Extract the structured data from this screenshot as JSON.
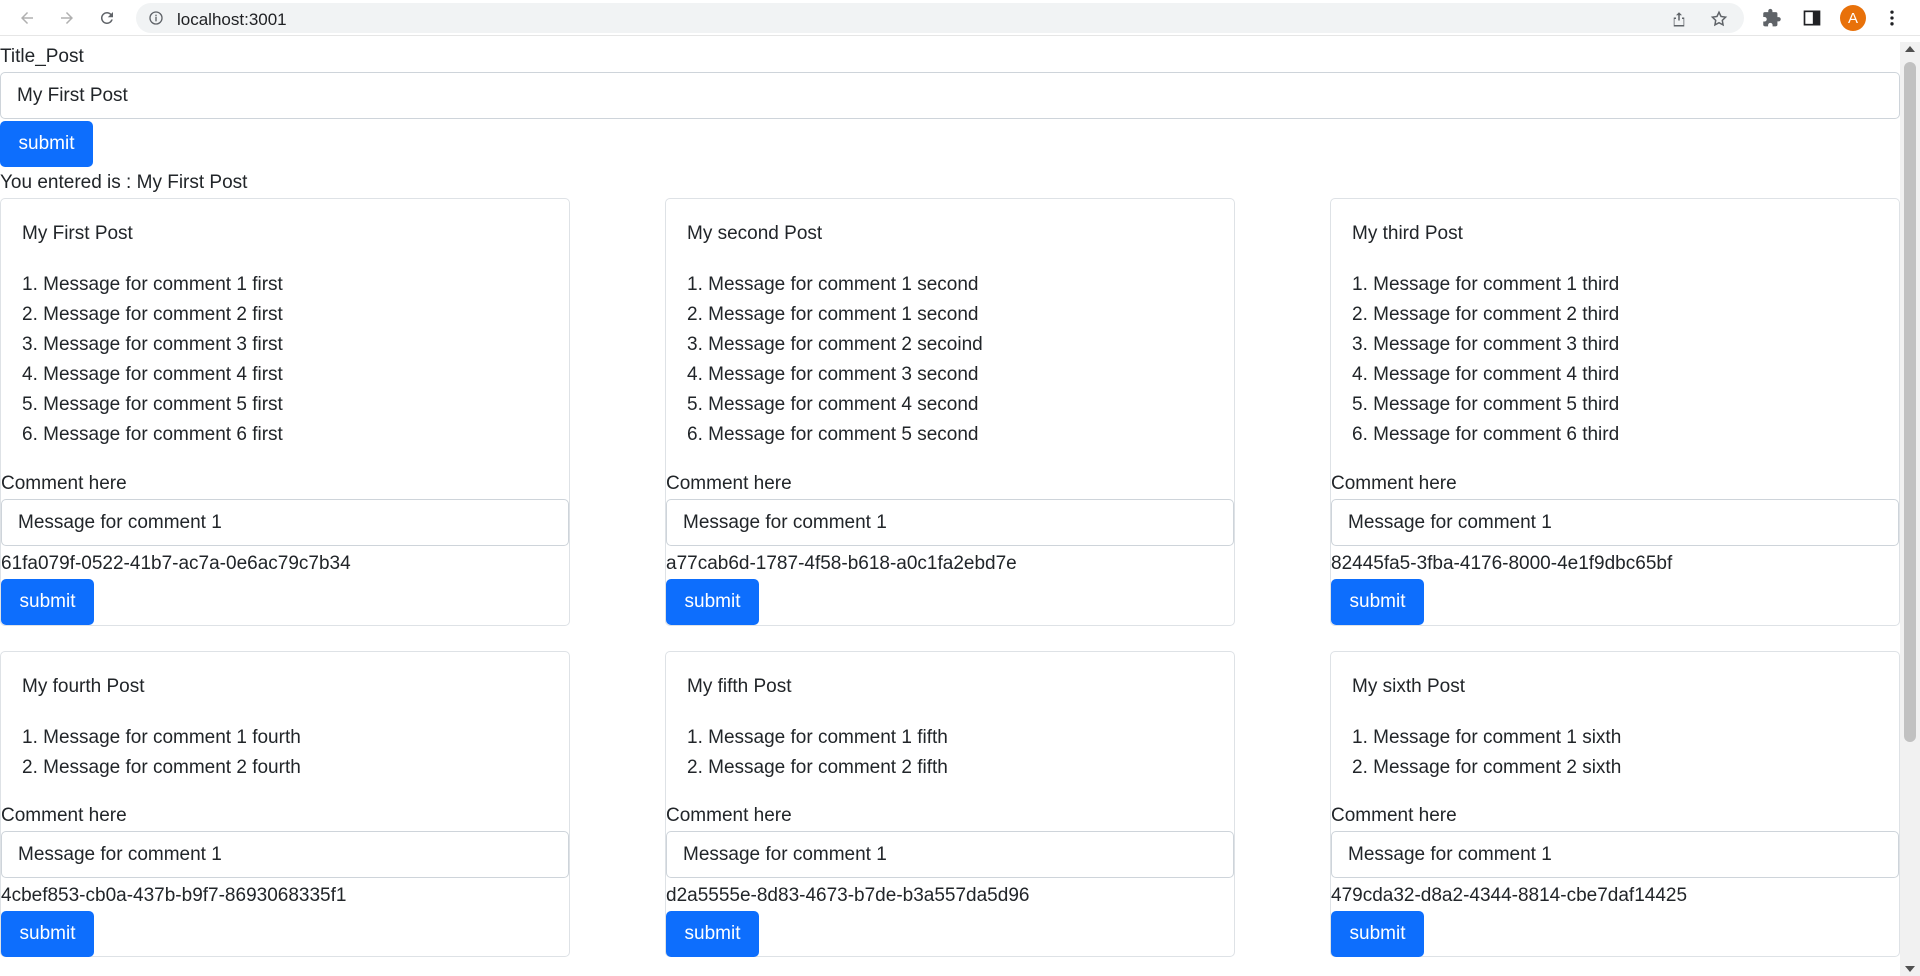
{
  "browser": {
    "url": "localhost:3001",
    "avatar_letter": "A",
    "accent": "#e8710a"
  },
  "form": {
    "title_label": "Title_Post",
    "title_value": "My First Post",
    "submit_label": "submit",
    "entered_text": "You entered is : My First Post"
  },
  "posts": [
    {
      "title": "My First Post",
      "comments": [
        "1. Message for comment 1 first",
        "2. Message for comment 2 first",
        "3. Message for comment 3 first",
        "4. Message for comment 4 first",
        "5. Message for comment 5 first",
        "6. Message for comment 6 first"
      ],
      "comment_label": "Comment here",
      "comment_value": "Message for comment 1",
      "id": "61fa079f-0522-41b7-ac7a-0e6ac79c7b34",
      "submit_label": "submit"
    },
    {
      "title": "My second Post",
      "comments": [
        "1. Message for comment 1 second",
        "2. Message for comment 1 second",
        "3. Message for comment 2 secoind",
        "4. Message for comment 3 second",
        "5. Message for comment 4 second",
        "6. Message for comment 5 second"
      ],
      "comment_label": "Comment here",
      "comment_value": "Message for comment 1",
      "id": "a77cab6d-1787-4f58-b618-a0c1fa2ebd7e",
      "submit_label": "submit"
    },
    {
      "title": "My third Post",
      "comments": [
        "1. Message for comment 1 third",
        "2. Message for comment 2 third",
        "3. Message for comment 3 third",
        "4. Message for comment 4 third",
        "5. Message for comment 5 third",
        "6. Message for comment 6 third"
      ],
      "comment_label": "Comment here",
      "comment_value": "Message for comment 1",
      "id": "82445fa5-3fba-4176-8000-4e1f9dbc65bf",
      "submit_label": "submit"
    },
    {
      "title": "My fourth Post",
      "comments": [
        "1. Message for comment 1 fourth",
        "2. Message for comment 2 fourth"
      ],
      "comment_label": "Comment here",
      "comment_value": "Message for comment 1",
      "id": "4cbef853-cb0a-437b-b9f7-8693068335f1",
      "submit_label": "submit"
    },
    {
      "title": "My fifth Post",
      "comments": [
        "1. Message for comment 1 fifth",
        "2. Message for comment 2 fifth"
      ],
      "comment_label": "Comment here",
      "comment_value": "Message for comment 1",
      "id": "d2a5555e-8d83-4673-b7de-b3a557da5d96",
      "submit_label": "submit"
    },
    {
      "title": "My sixth Post",
      "comments": [
        "1. Message for comment 1 sixth",
        "2. Message for comment 2 sixth"
      ],
      "comment_label": "Comment here",
      "comment_value": "Message for comment 1",
      "id": "479cda32-d8a2-4344-8814-cbe7daf14425",
      "submit_label": "submit"
    }
  ],
  "colors": {
    "primary_button": "#0d6efd",
    "border": "#dee2e6"
  }
}
